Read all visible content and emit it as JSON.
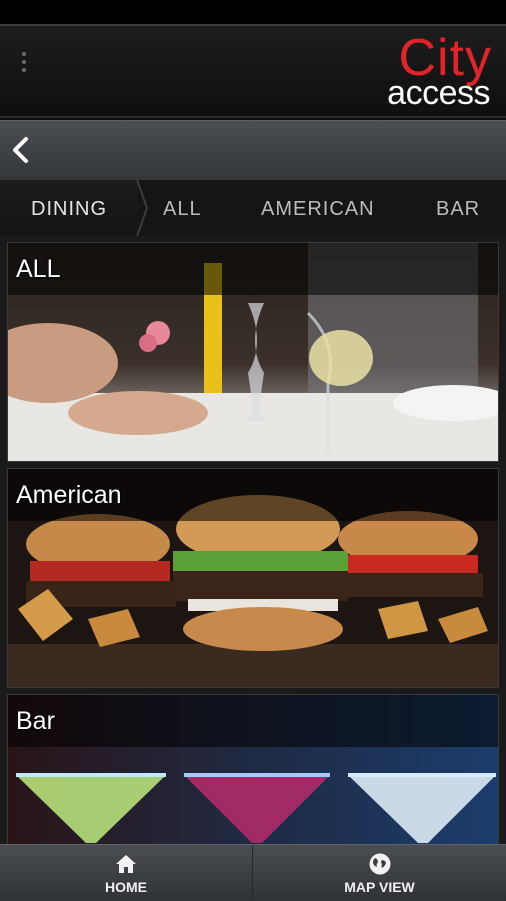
{
  "header": {
    "menu_icon": "overflow-menu-icon",
    "logo": {
      "line1": "City",
      "line2": "access",
      "accent_color": "#e1242b"
    }
  },
  "nav": {
    "back_icon": "chevron-left-icon"
  },
  "tabs": [
    {
      "label": "DINING",
      "selected": true
    },
    {
      "label": "ALL"
    },
    {
      "label": "AMERICAN"
    },
    {
      "label": "BAR"
    }
  ],
  "categories": [
    {
      "label": "ALL",
      "image": "fine-dining-table-photo"
    },
    {
      "label": "American",
      "image": "burgers-and-fries-photo"
    },
    {
      "label": "Bar",
      "image": "cocktail-glasses-photo"
    }
  ],
  "bottom_nav": [
    {
      "label": "HOME",
      "icon": "home-icon"
    },
    {
      "label": "MAP VIEW",
      "icon": "globe-icon"
    }
  ]
}
